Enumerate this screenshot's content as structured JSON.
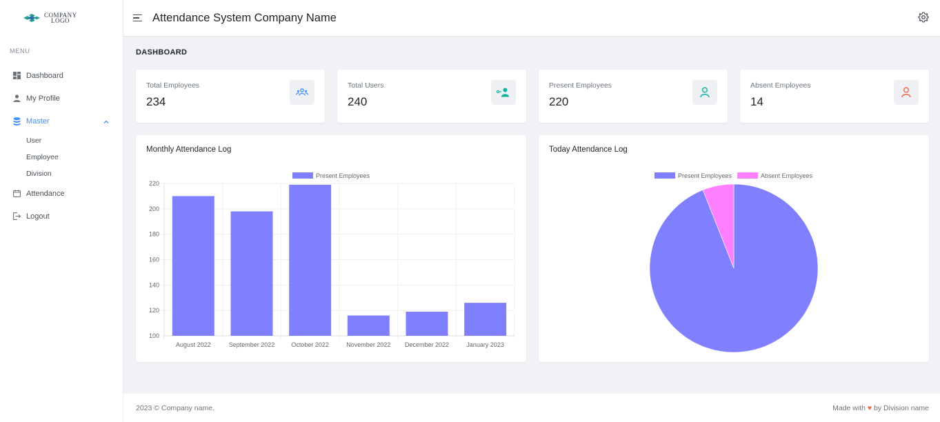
{
  "logo": {
    "text_line1": "COMPANY",
    "text_line2": "LOGO"
  },
  "header": {
    "title": "Attendance System Company Name"
  },
  "sidebar": {
    "menu_title": "MENU",
    "items": [
      {
        "label": "Dashboard",
        "icon": "dashboard-icon"
      },
      {
        "label": "My Profile",
        "icon": "user-icon"
      },
      {
        "label": "Master",
        "icon": "database-icon"
      },
      {
        "label": "Attendance",
        "icon": "calendar-icon"
      },
      {
        "label": "Logout",
        "icon": "logout-icon"
      }
    ],
    "master_sub": [
      "User",
      "Employee",
      "Division"
    ]
  },
  "page": {
    "title": "DASHBOARD"
  },
  "stats": [
    {
      "label": "Total Employees",
      "value": "234",
      "icon": "users-group-icon",
      "color": "#3e8ef7"
    },
    {
      "label": "Total Users",
      "value": "240",
      "icon": "user-share-icon",
      "color": "#0ab39c"
    },
    {
      "label": "Present Employees",
      "value": "220",
      "icon": "user-check-icon",
      "color": "#0ab39c"
    },
    {
      "label": "Absent Employees",
      "value": "14",
      "icon": "user-x-icon",
      "color": "#f06548"
    }
  ],
  "monthly": {
    "title": "Monthly Attendance Log"
  },
  "today": {
    "title": "Today Attendance Log"
  },
  "chart_data": [
    {
      "type": "bar",
      "title": "Monthly Attendance Log",
      "categories": [
        "August 2022",
        "September 2022",
        "October 2022",
        "November 2022",
        "December 2022",
        "January 2023"
      ],
      "series": [
        {
          "name": "Present Employees",
          "values": [
            210,
            198,
            219,
            116,
            119,
            126
          ],
          "color": "#8080ff"
        }
      ],
      "ylim": [
        100,
        220
      ],
      "yticks": [
        100,
        120,
        140,
        160,
        180,
        200,
        220
      ],
      "grid": true,
      "legend": "top"
    },
    {
      "type": "pie",
      "title": "Today Attendance Log",
      "labels": [
        "Present Employees",
        "Absent Employees"
      ],
      "values": [
        220,
        14
      ],
      "colors": [
        "#8080ff",
        "#ff80ff"
      ],
      "legend": "top"
    }
  ],
  "footer": {
    "left": "2023 © Company name.",
    "made_with": "Made with",
    "by": "by Division name"
  }
}
